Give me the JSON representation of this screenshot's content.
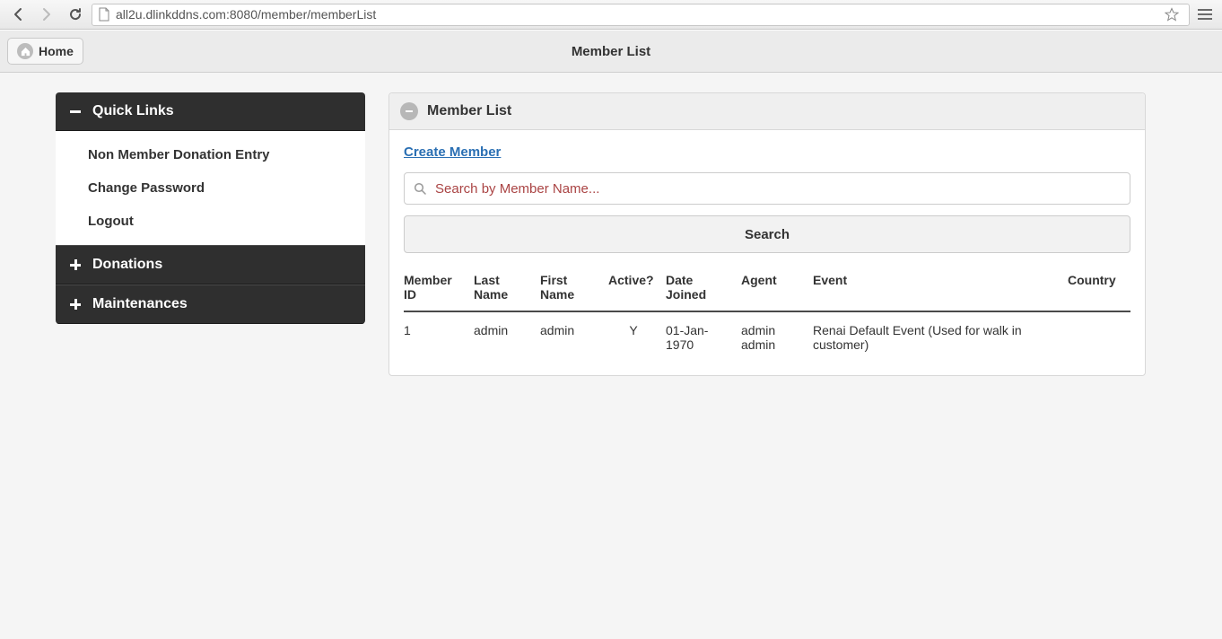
{
  "browser": {
    "url": "all2u.dlinkddns.com:8080/member/memberList"
  },
  "topbar": {
    "home_label": "Home",
    "title": "Member List"
  },
  "sidebar": {
    "quick_links": {
      "label": "Quick Links",
      "items": [
        {
          "label": "Non Member Donation Entry"
        },
        {
          "label": "Change Password"
        },
        {
          "label": "Logout"
        }
      ]
    },
    "donations": {
      "label": "Donations"
    },
    "maintenances": {
      "label": "Maintenances"
    }
  },
  "main": {
    "panel_title": "Member List",
    "create_link": "Create Member",
    "search": {
      "placeholder": "Search by Member Name..."
    },
    "search_button": "Search",
    "table": {
      "headers": {
        "member_id": "Member ID",
        "last_name": "Last Name",
        "first_name": "First Name",
        "active": "Active?",
        "date_joined": "Date Joined",
        "agent": "Agent",
        "event": "Event",
        "country": "Country"
      },
      "rows": [
        {
          "member_id": "1",
          "last_name": "admin",
          "first_name": "admin",
          "active": "Y",
          "date_joined": "01-Jan-1970",
          "agent": "admin admin",
          "event": "Renai Default Event (Used for walk in customer)",
          "country": ""
        }
      ]
    }
  }
}
